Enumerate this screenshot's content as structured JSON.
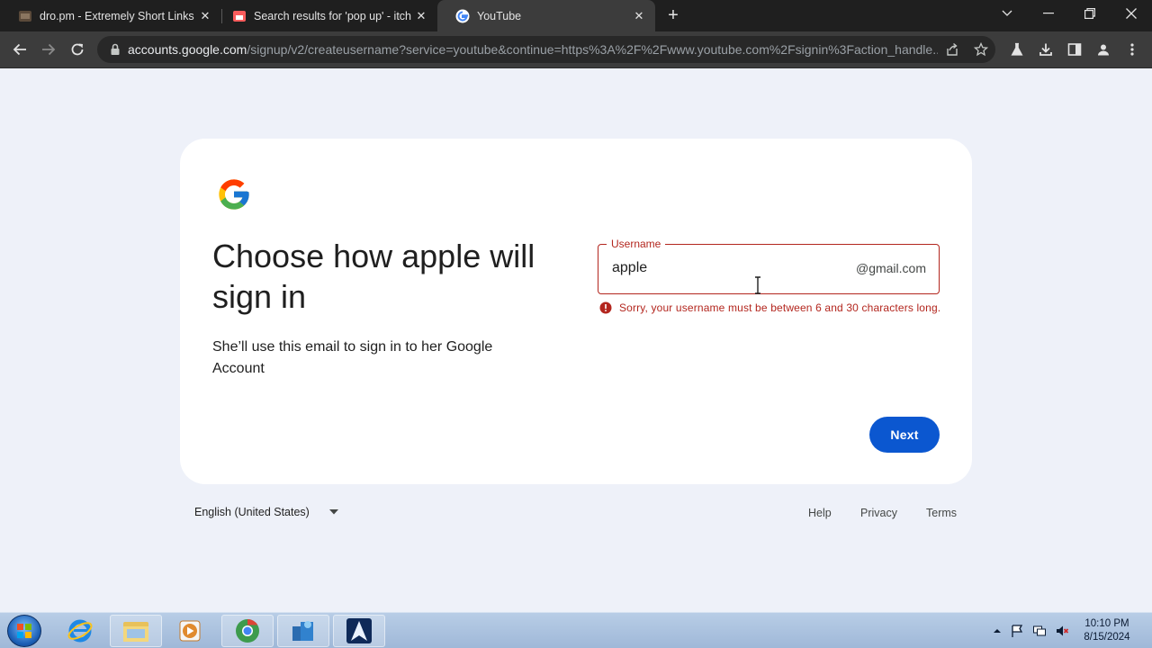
{
  "browser": {
    "tabs": [
      {
        "title": "dro.pm - Extremely Short Links",
        "favicon": "dro-favicon"
      },
      {
        "title": "Search results for 'pop up' - itch",
        "favicon": "itch-favicon"
      },
      {
        "title": "YouTube",
        "favicon": "google-favicon",
        "active": true
      }
    ],
    "url_host": "accounts.google.com",
    "url_path": "/signup/v2/createusername?service=youtube&continue=https%3A%2F%2Fwww.youtube.com%2Fsignin%3Faction_handle..."
  },
  "page": {
    "heading": "Choose how apple will sign in",
    "subtext": "She’ll use this email to sign in to her Google Account",
    "username": {
      "label": "Username",
      "value": "apple",
      "suffix": "@gmail.com"
    },
    "error": "Sorry, your username must be between 6 and 30 characters long.",
    "next_label": "Next"
  },
  "footer": {
    "language": "English (United States)",
    "links": [
      "Help",
      "Privacy",
      "Terms"
    ]
  },
  "taskbar": {
    "time": "10:10 PM",
    "date": "8/15/2024"
  },
  "colors": {
    "error": "#b3261e",
    "primary": "#0b57d0",
    "page_bg": "#eef1f9"
  }
}
